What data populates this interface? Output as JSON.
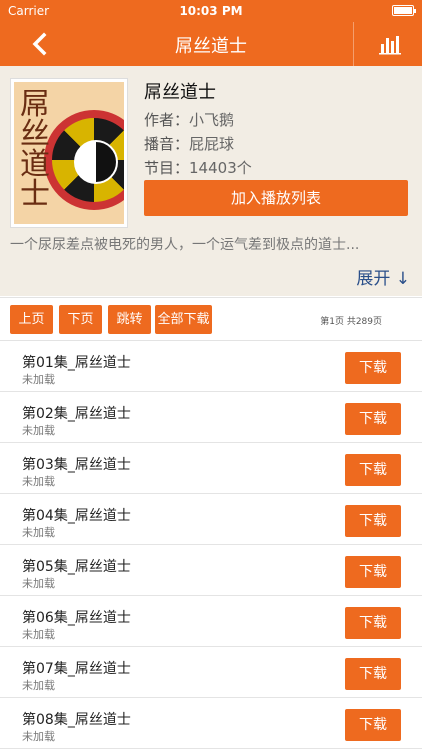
{
  "status_bar": {
    "carrier": "Carrier",
    "time": "10:03 PM"
  },
  "nav": {
    "title": "屌丝道士",
    "back_icon": "chevron-left-icon",
    "stats_icon": "bar-chart-icon"
  },
  "book": {
    "cover_text": "屌丝道士",
    "name": "屌丝道士",
    "author_label": "作者：",
    "author": "小飞鹅",
    "narrator_label": "播音：",
    "narrator": "屁屁球",
    "episodes_label": "节目：",
    "episodes": "14403个",
    "add_button": "加入播放列表",
    "description": "一个尿尿差点被电死的男人，一个运气差到极点的道士...",
    "expand": "展开 ↓"
  },
  "toolbar": {
    "prev": "上页",
    "next": "下页",
    "jump": "跳转",
    "download_all": "全部下载",
    "page_info": "第1页 共289页"
  },
  "episodes": [
    {
      "title": "第01集_屌丝道士",
      "status": "未加载",
      "action": "下载"
    },
    {
      "title": "第02集_屌丝道士",
      "status": "未加载",
      "action": "下载"
    },
    {
      "title": "第03集_屌丝道士",
      "status": "未加载",
      "action": "下载"
    },
    {
      "title": "第04集_屌丝道士",
      "status": "未加载",
      "action": "下载"
    },
    {
      "title": "第05集_屌丝道士",
      "status": "未加载",
      "action": "下载"
    },
    {
      "title": "第06集_屌丝道士",
      "status": "未加载",
      "action": "下载"
    },
    {
      "title": "第07集_屌丝道士",
      "status": "未加载",
      "action": "下载"
    },
    {
      "title": "第08集_屌丝道士",
      "status": "未加载",
      "action": "下载"
    }
  ],
  "colors": {
    "accent": "#ee6a1f",
    "panel": "#f2ede4",
    "link": "#2a4f8a"
  }
}
